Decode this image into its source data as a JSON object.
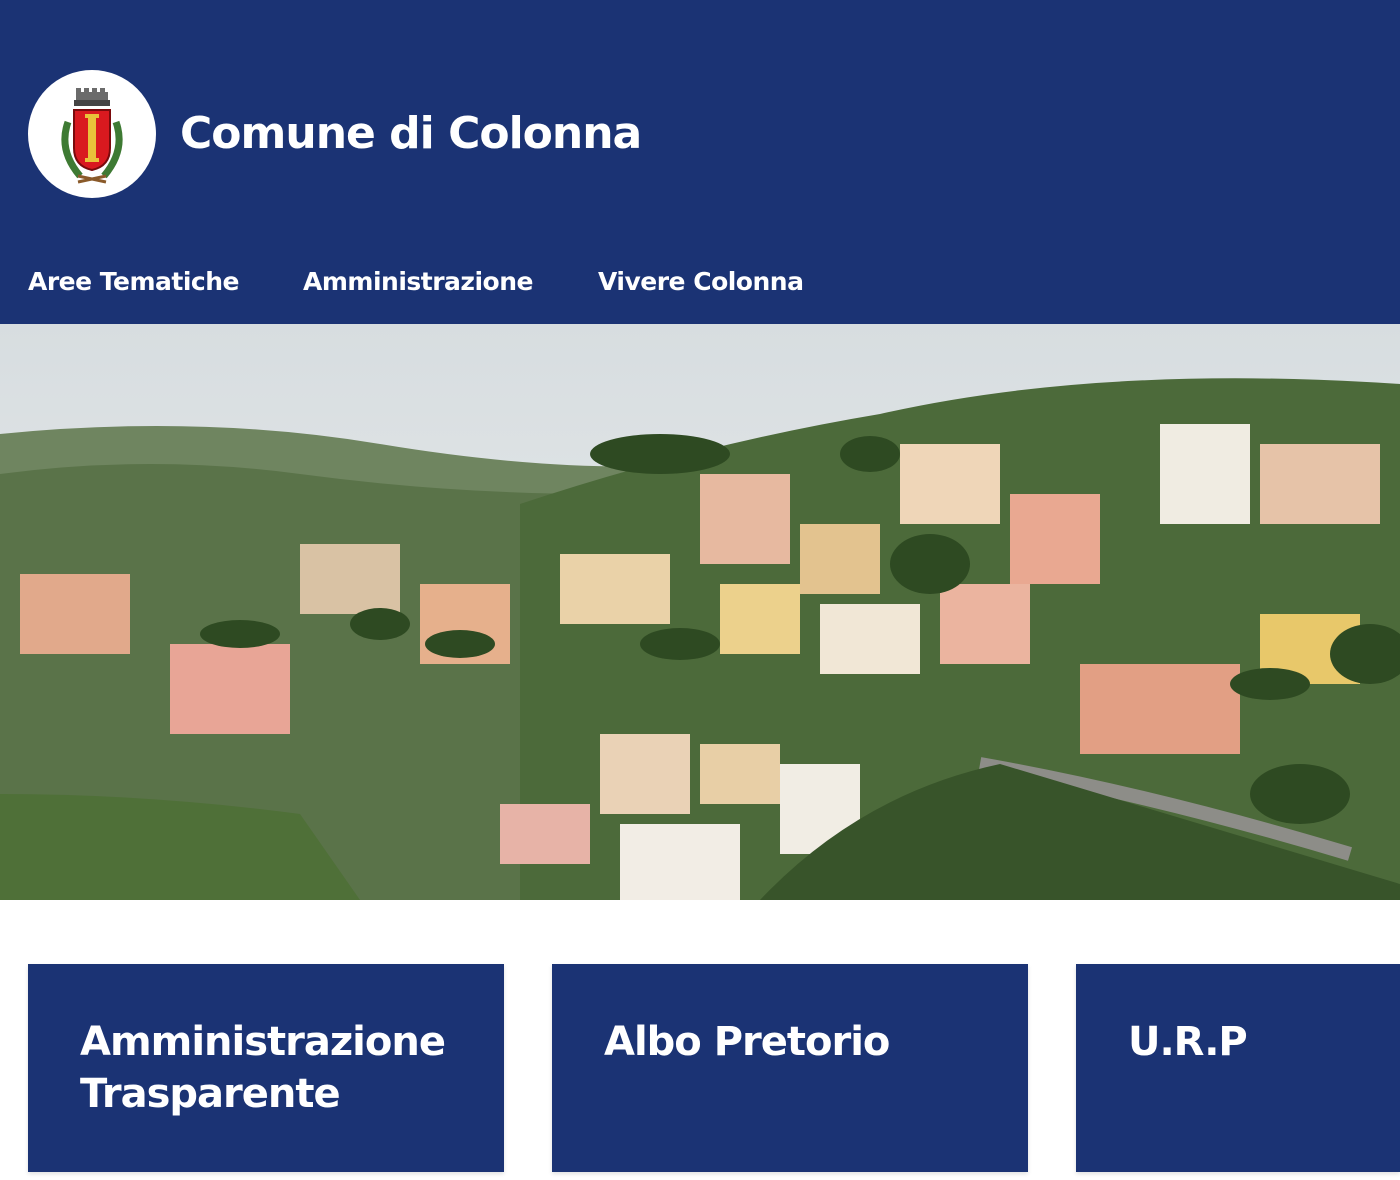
{
  "header": {
    "title": "Comune di Colonna",
    "logo_icon": "coat-of-arms-icon",
    "background": "#1b3374"
  },
  "nav": {
    "items": [
      {
        "label": "Aree Tematiche"
      },
      {
        "label": "Amministrazione"
      },
      {
        "label": "Vivere Colonna"
      }
    ]
  },
  "hero": {
    "image": "panorama-of-colonna-town"
  },
  "cards": [
    {
      "line1": "Amministrazione",
      "line2": "Trasparente"
    },
    {
      "line1": "Albo Pretorio",
      "line2": ""
    },
    {
      "line1": "U.R.P",
      "line2": ""
    }
  ]
}
